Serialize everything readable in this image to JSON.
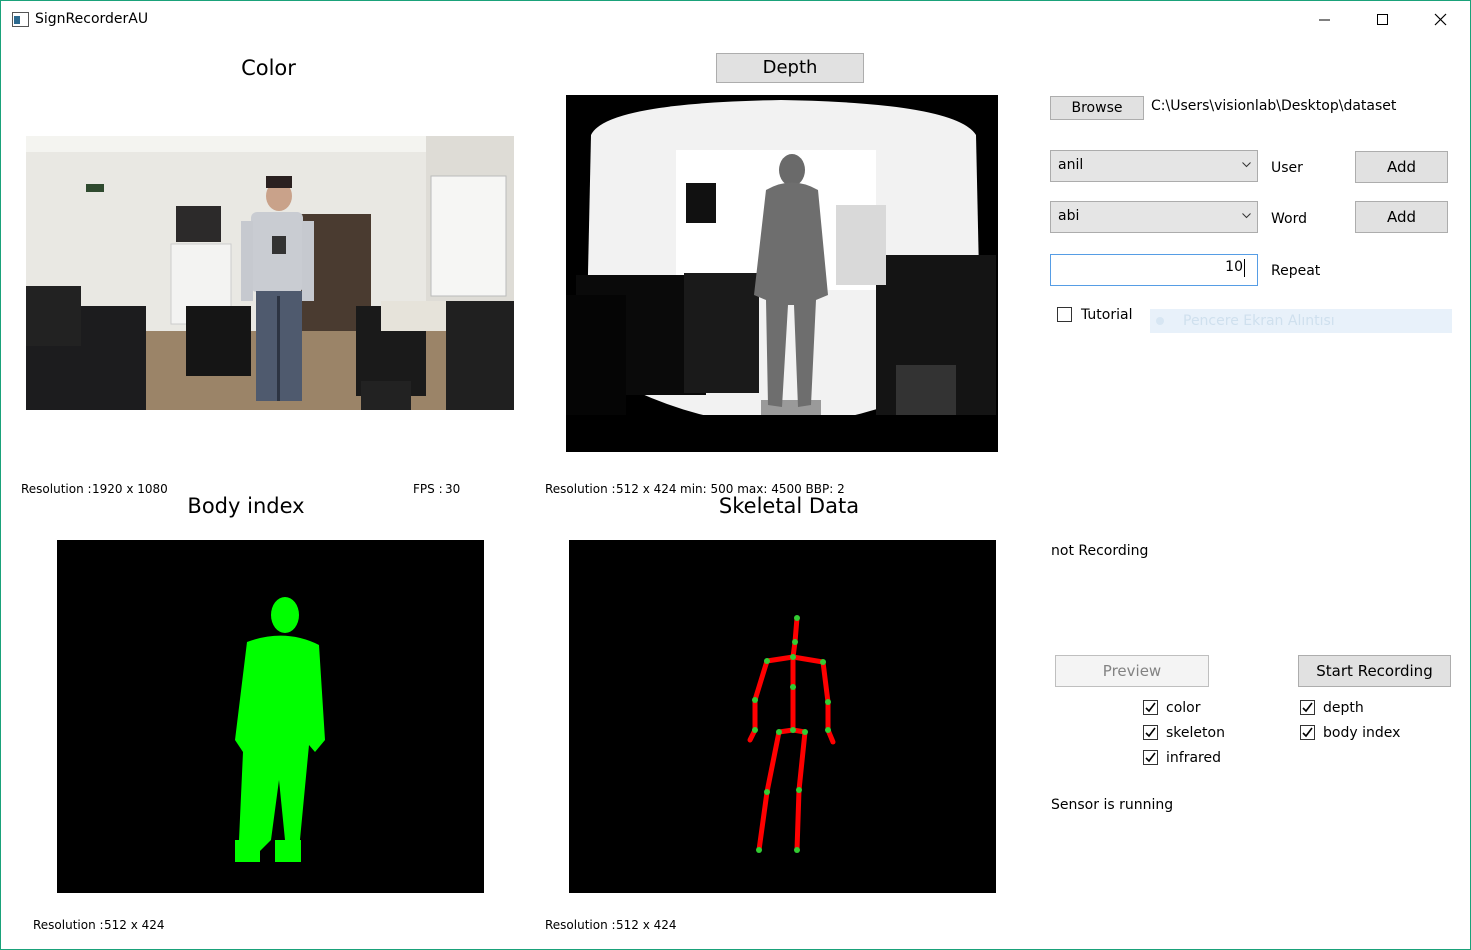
{
  "window": {
    "title": "SignRecorderAU"
  },
  "color": {
    "heading": "Color",
    "resolution_label": "Resolution :",
    "resolution_value": "1920 x 1080",
    "fps_label": "FPS :",
    "fps_value": "30"
  },
  "depth": {
    "heading_button": "Depth",
    "resolution_label": "Resolution :",
    "resolution_value": "512 x 424",
    "extra": "min: 500   max: 4500 BBP: 2"
  },
  "body_index": {
    "heading": "Body index",
    "resolution_label": "Resolution :",
    "resolution_value": "512 x 424"
  },
  "skeletal": {
    "heading": "Skeletal Data",
    "resolution_label": "Resolution :",
    "resolution_value": "512 x 424"
  },
  "controls": {
    "browse_label": "Browse",
    "path": "C:\\Users\\visionlab\\Desktop\\dataset",
    "user_selected": "anil",
    "user_label": "User",
    "user_add": "Add",
    "word_selected": "abi",
    "word_label": "Word",
    "word_add": "Add",
    "repeat_value": "10",
    "repeat_label": "Repeat",
    "tutorial_label": "Tutorial",
    "tutorial_checked": false,
    "ghost_text": "Pencere Ekran Alıntısı"
  },
  "status": {
    "recording": "not Recording",
    "sensor": "Sensor is running"
  },
  "recording": {
    "preview_label": "Preview",
    "start_label": "Start Recording",
    "checks": {
      "color": "color",
      "skeleton": "skeleton",
      "infrared": "infrared",
      "depth": "depth",
      "body_index": "body index"
    }
  },
  "colors": {
    "accent_border": "#569de5",
    "body_green": "#00ff00",
    "skeleton_red": "#ff0000",
    "joint_green": "#33cc33"
  }
}
